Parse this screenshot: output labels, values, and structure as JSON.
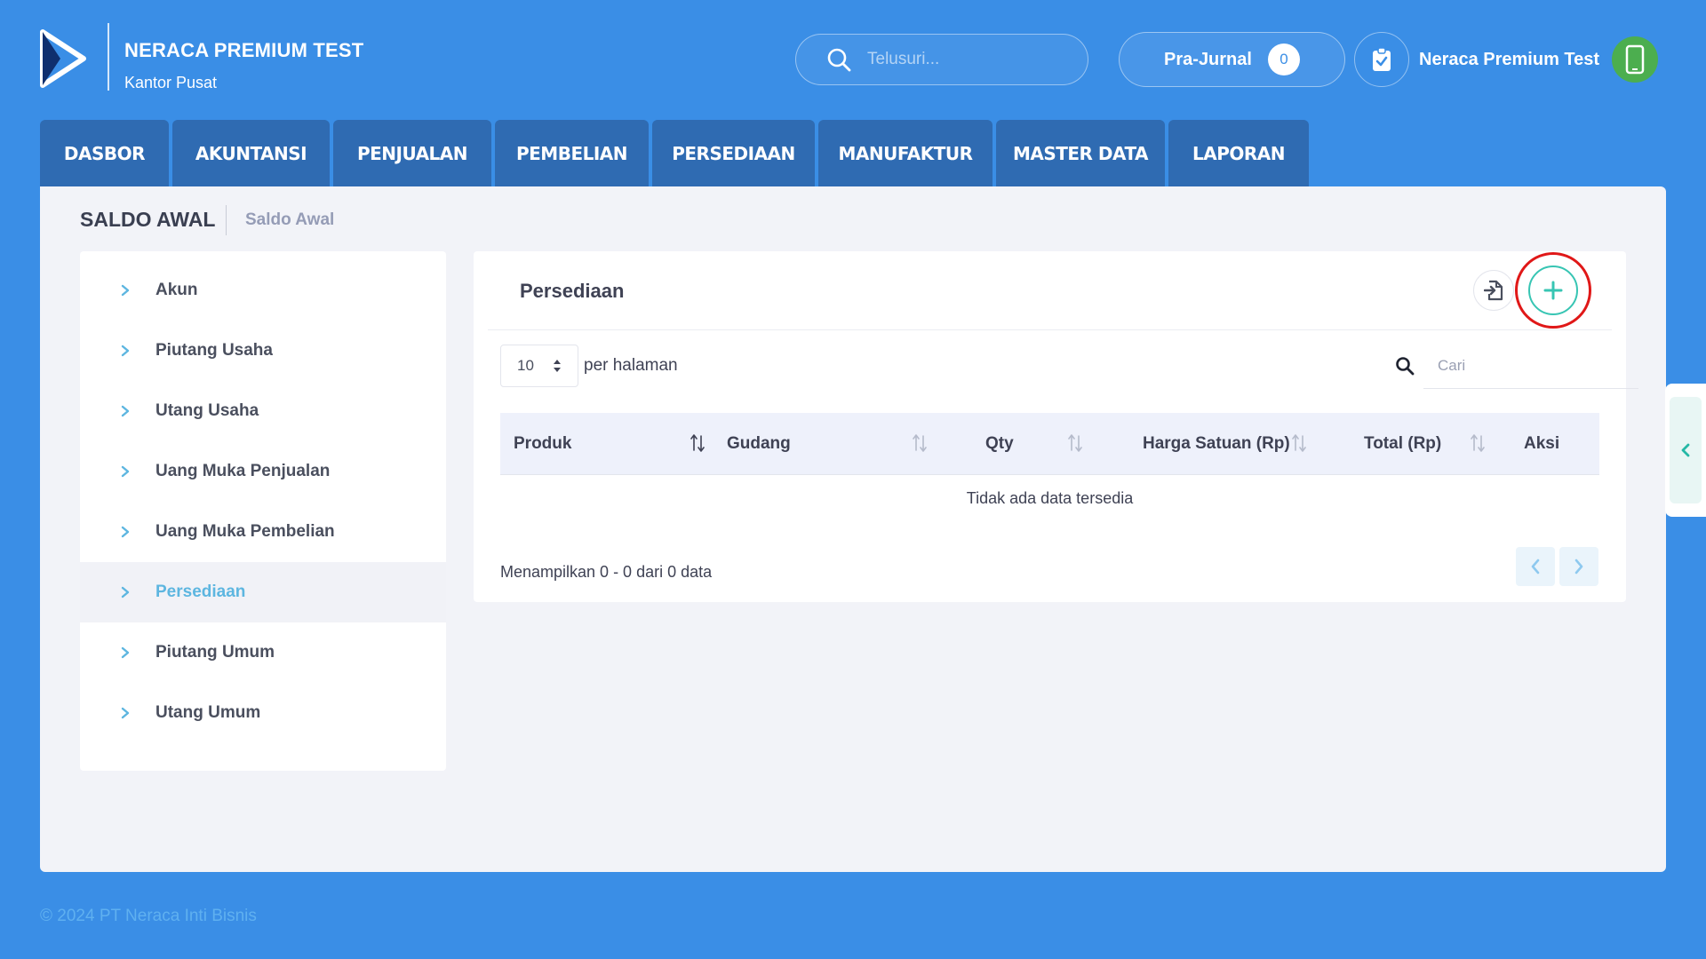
{
  "header": {
    "company_name": "NERACA PREMIUM TEST",
    "branch": "Kantor Pusat",
    "search_placeholder": "Telusuri...",
    "prajurnal_label": "Pra-Jurnal",
    "prajurnal_count": "0",
    "user_name": "Neraca Premium Test"
  },
  "nav": {
    "tabs": [
      "DASBOR",
      "AKUNTANSI",
      "PENJUALAN",
      "PEMBELIAN",
      "PERSEDIAAN",
      "MANUFAKTUR",
      "MASTER DATA",
      "LAPORAN"
    ]
  },
  "page": {
    "title": "SALDO AWAL",
    "breadcrumb": "Saldo Awal"
  },
  "sidebar": {
    "items": [
      "Akun",
      "Piutang Usaha",
      "Utang Usaha",
      "Uang Muka Penjualan",
      "Uang Muka Pembelian",
      "Persediaan",
      "Piutang Umum",
      "Utang Umum"
    ],
    "active": "Persediaan"
  },
  "card": {
    "title": "Persediaan",
    "page_size": "10",
    "per_page_label": "per halaman",
    "search_placeholder": "Cari",
    "columns": [
      "Produk",
      "Gudang",
      "Qty",
      "Harga Satuan (Rp)",
      "Total (Rp)",
      "Aksi"
    ],
    "empty_text": "Tidak ada data tersedia",
    "footer_info": "Menampilkan 0 - 0 dari 0 data"
  },
  "footer": {
    "copyright": "© 2024 PT Neraca Inti Bisnis"
  },
  "colors": {
    "background": "#3a8ee6",
    "nav_tab": "#2f6bb2",
    "accent_teal": "#37c5b3",
    "active_item": "#5db6e0",
    "highlight_ring": "#e01818",
    "avatar": "#4cae4f"
  }
}
